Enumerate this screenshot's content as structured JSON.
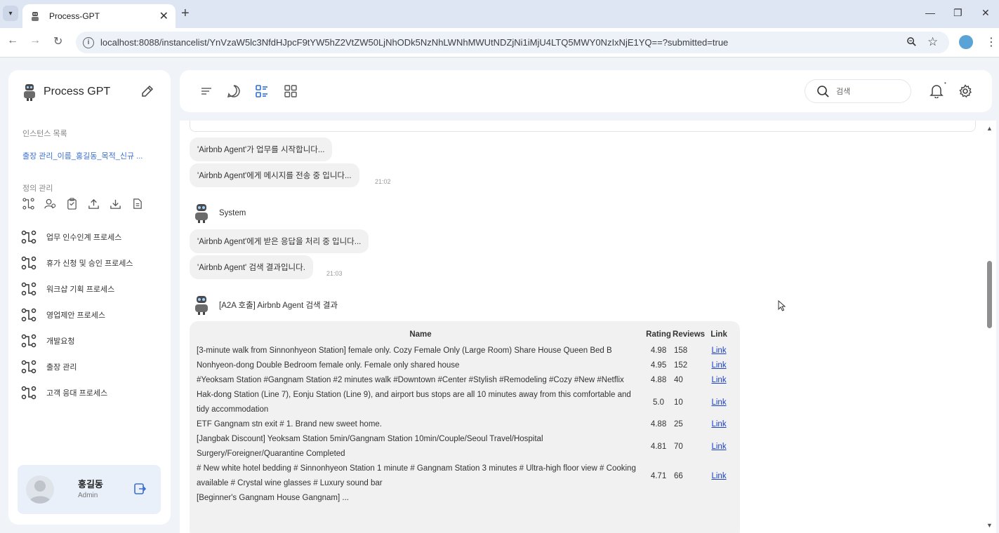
{
  "browser": {
    "tab_title": "Process-GPT",
    "url": "localhost:8088/instancelist/YnVzaW5lc3NfdHJpcF9tYW5hZ2VtZW50LjNhODk5NzNhLWNhMWUtNDZjNi1iMjU4LTQ5MWY0NzIxNjE1YQ==?submitted=true",
    "icons": [
      "tab-menu-icon",
      "favicon-robot-icon",
      "close-icon",
      "plus-icon",
      "minimize-icon",
      "restore-icon",
      "close-window-icon",
      "back-icon",
      "forward-icon",
      "reload-icon",
      "info-icon",
      "zoom-icon",
      "star-icon",
      "profile-icon",
      "kebab-icon"
    ]
  },
  "sidebar": {
    "brand": "Process GPT",
    "instance_section_label": "인스턴스 목록",
    "instance_link": "출장 관리_이름_홍길동_목적_신규 ...",
    "definition_section_label": "정의 관리",
    "processes": [
      {
        "label": "업무 인수인계 프로세스"
      },
      {
        "label": "휴가 신청 및 승인 프로세스"
      },
      {
        "label": "워크샵 기획 프로세스"
      },
      {
        "label": "영업제안 프로세스"
      },
      {
        "label": "개발요청"
      },
      {
        "label": "출장 관리"
      },
      {
        "label": "고객 응대 프로세스"
      }
    ],
    "user": {
      "name": "홍길동",
      "role": "Admin"
    }
  },
  "topbar": {
    "search_placeholder": "검색",
    "notification_dot": "•"
  },
  "chat": {
    "messages_group1": [
      {
        "text": "'Airbnb Agent'가 업무를 시작합니다..."
      },
      {
        "text": "'Airbnb Agent'에게 메시지를 전송 중 입니다..."
      }
    ],
    "time1": "21:02",
    "sender2": "System",
    "messages_group2": [
      {
        "text": "'Airbnb Agent'에게 받은 응답을 처리 중 입니다..."
      },
      {
        "text": "'Airbnb Agent' 검색 결과입니다."
      }
    ],
    "time2": "21:03",
    "sender3": "[A2A 호출] Airbnb Agent 검색 결과",
    "table": {
      "headers": {
        "name": "Name",
        "rating": "Rating",
        "reviews": "Reviews",
        "link": "Link"
      },
      "rows": [
        {
          "name": "[3-minute walk from Sinnonhyeon Station] female only. Cozy Female Only (Large Room) Share House Queen Bed B",
          "rating": "4.98",
          "reviews": "158",
          "link": "Link"
        },
        {
          "name": "Nonhyeon-dong Double Bedroom female only. Female only shared house",
          "rating": "4.95",
          "reviews": "152",
          "link": "Link"
        },
        {
          "name": "#Yeoksam Station #Gangnam Station #2 minutes walk #Downtown #Center #Stylish #Remodeling #Cozy #New #Netflix",
          "rating": "4.88",
          "reviews": "40",
          "link": "Link"
        },
        {
          "name": "Hak-dong Station (Line 7), Eonju Station (Line 9), and airport bus stops are all 10 minutes away from this comfortable and tidy accommodation",
          "rating": "5.0",
          "reviews": "10",
          "link": "Link"
        },
        {
          "name": "ETF Gangnam stn exit # 1. Brand new sweet home.",
          "rating": "4.88",
          "reviews": "25",
          "link": "Link"
        },
        {
          "name": "[Jangbak Discount] Yeoksam Station 5min/Gangnam Station 10min/Couple/Seoul Travel/Hospital Surgery/Foreigner/Quarantine Completed",
          "rating": "4.81",
          "reviews": "70",
          "link": "Link"
        },
        {
          "name": "# New white hotel bedding # Sinnonhyeon Station 1 minute # Gangnam Station 3 minutes # Ultra-high floor view # Cooking available # Crystal wine glasses # Luxury sound bar",
          "rating": "4.71",
          "reviews": "66",
          "link": "Link"
        },
        {
          "name": "[Beginner's Gangnam House Gangnam] ...",
          "rating": "",
          "reviews": "",
          "link": ""
        }
      ]
    }
  },
  "colors": {
    "accent": "#3b6fd3",
    "link": "#1a3fc9",
    "bubble": "#f1f1f1",
    "app_bg": "#f0f3f8"
  }
}
